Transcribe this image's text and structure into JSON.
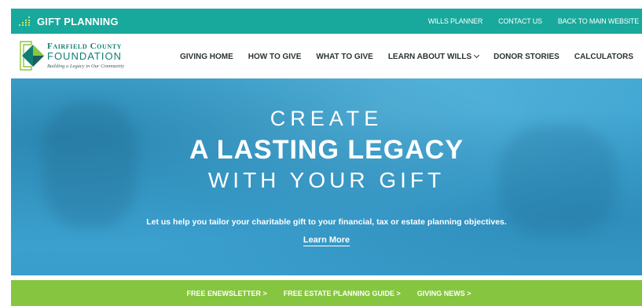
{
  "topbar": {
    "brand": "GIFT PLANNING",
    "brand_icon": "bars-chart-icon",
    "links": [
      "WILLS PLANNER",
      "CONTACT US",
      "BACK TO MAIN WEBSITE"
    ]
  },
  "logo": {
    "line1": "Fairfield County",
    "line2": "FOUNDATION",
    "tagline": "Building a Legacy in Our Community"
  },
  "nav": {
    "items": [
      "GIVING HOME",
      "HOW TO GIVE",
      "WHAT TO GIVE",
      "LEARN ABOUT WILLS",
      "DONOR STORIES",
      "CALCULATORS"
    ]
  },
  "hero": {
    "line1": "CREATE",
    "line2": "A LASTING LEGACY",
    "line3": "WITH YOUR GIFT",
    "subtitle": "Let us help you tailor your charitable gift to your financial, tax or estate planning objectives.",
    "cta": "Learn More"
  },
  "footer_links": [
    "FREE ENEWSLETTER >",
    "FREE ESTATE PLANNING GUIDE >",
    "GIVING NEWS >"
  ],
  "colors": {
    "teal": "#18a99c",
    "hero_blue": "#3ea4d2",
    "green": "#86c540",
    "logo_green": "#0f7f72"
  }
}
